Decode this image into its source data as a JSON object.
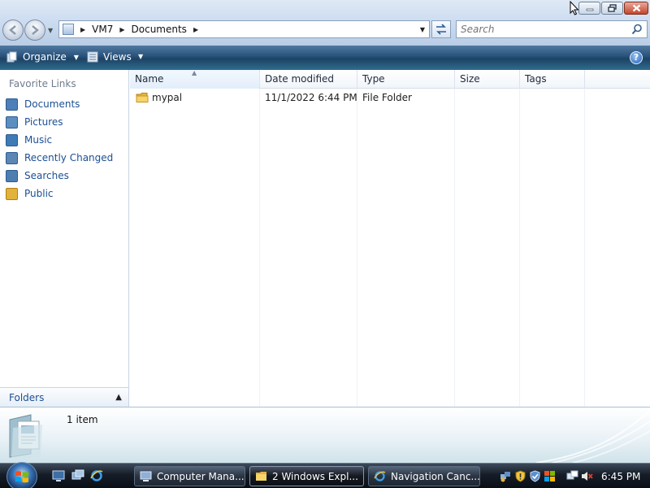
{
  "window": {
    "buttons": {
      "minimize_icon": "minimize-icon",
      "restore_icon": "restore-icon",
      "close_icon": "close-icon"
    }
  },
  "address": {
    "crumbs": [
      "VM7",
      "Documents"
    ]
  },
  "search": {
    "placeholder": "Search"
  },
  "toolbar": {
    "organize_label": "Organize",
    "views_label": "Views"
  },
  "sidebar": {
    "title": "Favorite Links",
    "items": [
      {
        "label": "Documents",
        "icon": "documents-icon",
        "color": "#4f7fb8"
      },
      {
        "label": "Pictures",
        "icon": "pictures-icon",
        "color": "#5a8fbf"
      },
      {
        "label": "Music",
        "icon": "music-icon",
        "color": "#3f7bb5"
      },
      {
        "label": "Recently Changed",
        "icon": "recently-changed-icon",
        "color": "#5c86b3"
      },
      {
        "label": "Searches",
        "icon": "searches-icon",
        "color": "#4c7fb0"
      },
      {
        "label": "Public",
        "icon": "public-folder-icon",
        "color": "#e2b33c"
      }
    ],
    "folders_label": "Folders"
  },
  "filelist": {
    "columns": [
      "Name",
      "Date modified",
      "Type",
      "Size",
      "Tags"
    ],
    "rows": [
      {
        "name": "mypal",
        "date": "11/1/2022 6:44 PM",
        "type": "File Folder",
        "size": "",
        "tags": ""
      }
    ]
  },
  "details": {
    "count": "1 item"
  },
  "taskbar": {
    "tasks": [
      {
        "label": "Computer Mana...",
        "icon": "computer-management-icon"
      },
      {
        "label": "2 Windows Expl...",
        "icon": "folder-icon"
      },
      {
        "label": "Navigation Canc...",
        "icon": "internet-explorer-icon"
      }
    ],
    "clock": "6:45 PM"
  },
  "colors": {
    "link_blue": "#1b4f93",
    "command_bar": "#27507a",
    "taskbar": "#161d27"
  }
}
